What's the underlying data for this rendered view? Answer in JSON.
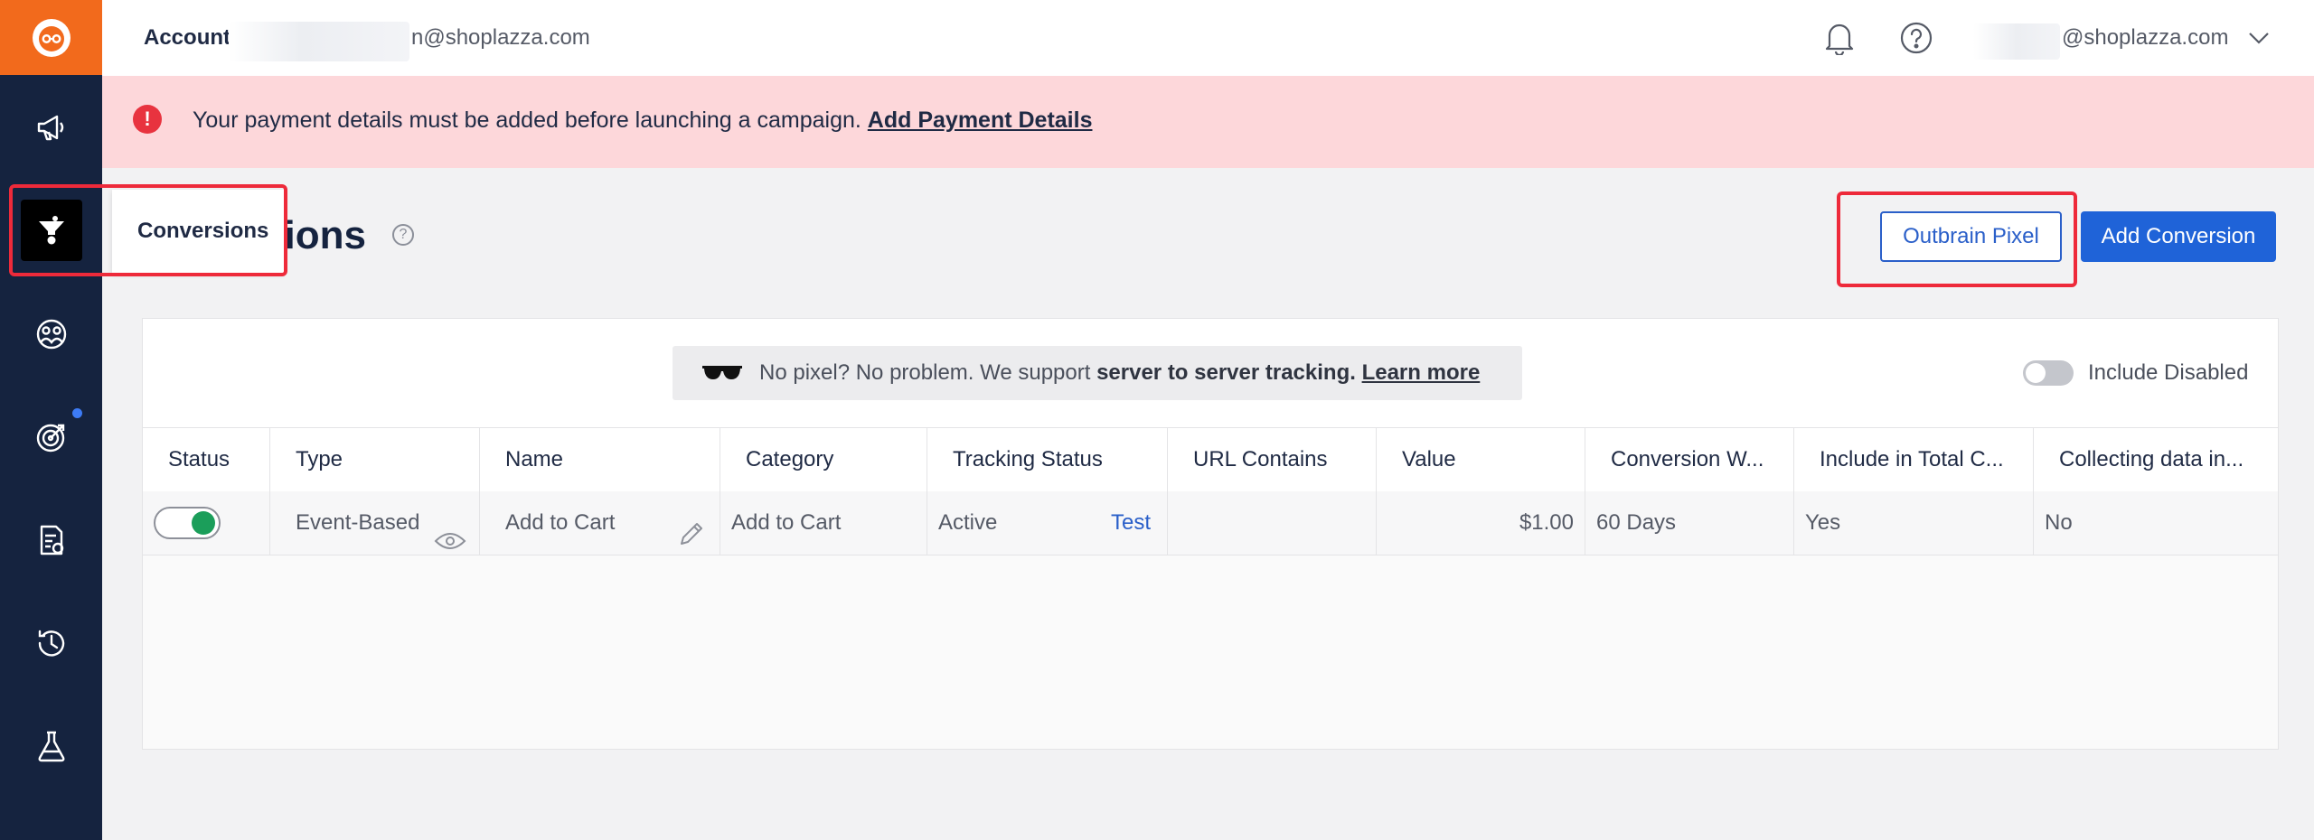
{
  "topbar": {
    "account_label": "Account",
    "account_email": "n@shoplazza.com",
    "user_email": "@shoplazza.com"
  },
  "alert": {
    "message": "Your payment details must be added before launching a campaign.",
    "link": "Add Payment Details"
  },
  "page": {
    "title_visible": "sions",
    "tooltip": "Conversions"
  },
  "actions": {
    "pixel_button": "Outbrain Pixel",
    "add_button": "Add Conversion"
  },
  "pixel_banner": {
    "text_pre": "No pixel? No problem. We support ",
    "text_bold": "server to server tracking.",
    "link": "Learn more"
  },
  "filter": {
    "include_disabled": "Include Disabled",
    "include_disabled_on": false
  },
  "table": {
    "columns": [
      "Status",
      "Type",
      "Name",
      "Category",
      "Tracking Status",
      "URL Contains",
      "Value",
      "Conversion W...",
      "Include in Total C...",
      "Collecting data in..."
    ],
    "rows": [
      {
        "status_on": true,
        "type": "Event-Based",
        "name": "Add to Cart",
        "category": "Add to Cart",
        "tracking_status": "Active",
        "test_link": "Test",
        "url_contains": "",
        "value": "$1.00",
        "conversion_window": "60 Days",
        "include_in_total": "Yes",
        "collecting_data": "No"
      }
    ]
  },
  "colors": {
    "sidebar": "#15233f",
    "logo": "#f26a1c",
    "alert_bg": "#fdd7da",
    "alert_icon": "#e8333f",
    "primary": "#1f63d8",
    "highlight": "#ee2a3a",
    "toggle_on": "#1b9e5a"
  },
  "icons": {
    "logo": "outbrain-logo-icon",
    "nav": [
      "megaphone-icon",
      "conversions-icon",
      "audience-icon",
      "target-icon",
      "report-icon",
      "history-icon",
      "lab-flask-icon"
    ],
    "top": [
      "bell-icon",
      "help-circle-icon",
      "chevron-down-icon"
    ]
  }
}
